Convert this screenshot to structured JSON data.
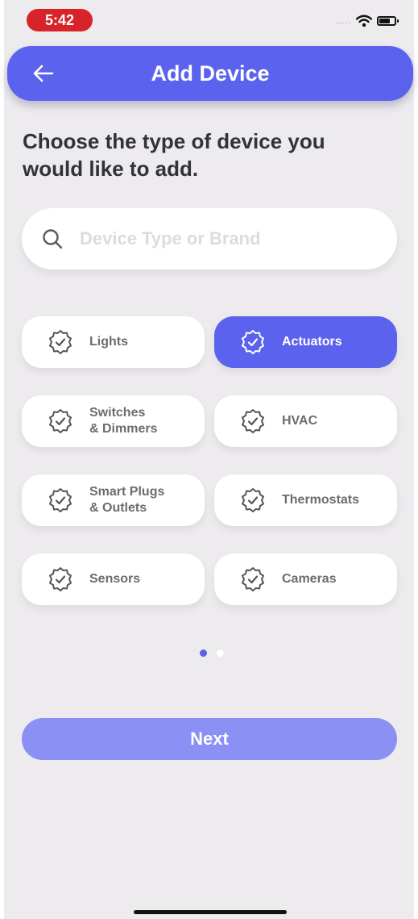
{
  "status_bar": {
    "time": "5:42",
    "signal": "....."
  },
  "header": {
    "title": "Add Device"
  },
  "prompt": "Choose the type of device you would like to add.",
  "search": {
    "placeholder": "Device Type or Brand",
    "value": ""
  },
  "device_types": [
    {
      "label": "Lights",
      "selected": false
    },
    {
      "label": "Actuators",
      "selected": true
    },
    {
      "label": "Switches\n& Dimmers",
      "selected": false
    },
    {
      "label": "HVAC",
      "selected": false
    },
    {
      "label": "Smart Plugs\n& Outlets",
      "selected": false
    },
    {
      "label": "Thermostats",
      "selected": false
    },
    {
      "label": "Sensors",
      "selected": false
    },
    {
      "label": "Cameras",
      "selected": false
    }
  ],
  "pager": {
    "pages": 2,
    "current": 1
  },
  "next_button": {
    "label": "Next"
  },
  "colors": {
    "accent": "#5b63ee",
    "accent_light": "#8a90f4",
    "background": "#edebee",
    "status_time_bg": "#d8232a"
  }
}
